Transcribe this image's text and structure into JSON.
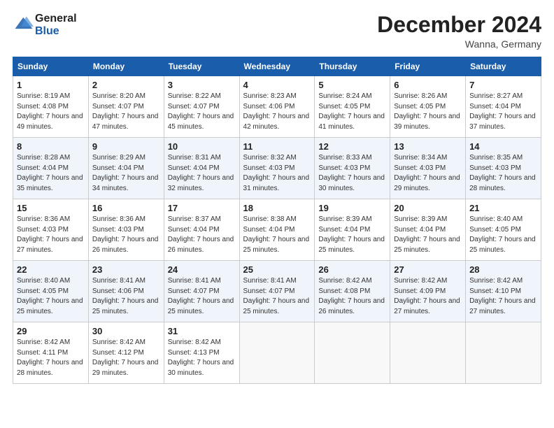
{
  "header": {
    "logo_general": "General",
    "logo_blue": "Blue",
    "month_title": "December 2024",
    "location": "Wanna, Germany"
  },
  "weekdays": [
    "Sunday",
    "Monday",
    "Tuesday",
    "Wednesday",
    "Thursday",
    "Friday",
    "Saturday"
  ],
  "weeks": [
    [
      {
        "day": "1",
        "sunrise": "8:19 AM",
        "sunset": "4:08 PM",
        "daylight": "7 hours and 49 minutes."
      },
      {
        "day": "2",
        "sunrise": "8:20 AM",
        "sunset": "4:07 PM",
        "daylight": "7 hours and 47 minutes."
      },
      {
        "day": "3",
        "sunrise": "8:22 AM",
        "sunset": "4:07 PM",
        "daylight": "7 hours and 45 minutes."
      },
      {
        "day": "4",
        "sunrise": "8:23 AM",
        "sunset": "4:06 PM",
        "daylight": "7 hours and 42 minutes."
      },
      {
        "day": "5",
        "sunrise": "8:24 AM",
        "sunset": "4:05 PM",
        "daylight": "7 hours and 41 minutes."
      },
      {
        "day": "6",
        "sunrise": "8:26 AM",
        "sunset": "4:05 PM",
        "daylight": "7 hours and 39 minutes."
      },
      {
        "day": "7",
        "sunrise": "8:27 AM",
        "sunset": "4:04 PM",
        "daylight": "7 hours and 37 minutes."
      }
    ],
    [
      {
        "day": "8",
        "sunrise": "8:28 AM",
        "sunset": "4:04 PM",
        "daylight": "7 hours and 35 minutes."
      },
      {
        "day": "9",
        "sunrise": "8:29 AM",
        "sunset": "4:04 PM",
        "daylight": "7 hours and 34 minutes."
      },
      {
        "day": "10",
        "sunrise": "8:31 AM",
        "sunset": "4:04 PM",
        "daylight": "7 hours and 32 minutes."
      },
      {
        "day": "11",
        "sunrise": "8:32 AM",
        "sunset": "4:03 PM",
        "daylight": "7 hours and 31 minutes."
      },
      {
        "day": "12",
        "sunrise": "8:33 AM",
        "sunset": "4:03 PM",
        "daylight": "7 hours and 30 minutes."
      },
      {
        "day": "13",
        "sunrise": "8:34 AM",
        "sunset": "4:03 PM",
        "daylight": "7 hours and 29 minutes."
      },
      {
        "day": "14",
        "sunrise": "8:35 AM",
        "sunset": "4:03 PM",
        "daylight": "7 hours and 28 minutes."
      }
    ],
    [
      {
        "day": "15",
        "sunrise": "8:36 AM",
        "sunset": "4:03 PM",
        "daylight": "7 hours and 27 minutes."
      },
      {
        "day": "16",
        "sunrise": "8:36 AM",
        "sunset": "4:03 PM",
        "daylight": "7 hours and 26 minutes."
      },
      {
        "day": "17",
        "sunrise": "8:37 AM",
        "sunset": "4:04 PM",
        "daylight": "7 hours and 26 minutes."
      },
      {
        "day": "18",
        "sunrise": "8:38 AM",
        "sunset": "4:04 PM",
        "daylight": "7 hours and 25 minutes."
      },
      {
        "day": "19",
        "sunrise": "8:39 AM",
        "sunset": "4:04 PM",
        "daylight": "7 hours and 25 minutes."
      },
      {
        "day": "20",
        "sunrise": "8:39 AM",
        "sunset": "4:04 PM",
        "daylight": "7 hours and 25 minutes."
      },
      {
        "day": "21",
        "sunrise": "8:40 AM",
        "sunset": "4:05 PM",
        "daylight": "7 hours and 25 minutes."
      }
    ],
    [
      {
        "day": "22",
        "sunrise": "8:40 AM",
        "sunset": "4:05 PM",
        "daylight": "7 hours and 25 minutes."
      },
      {
        "day": "23",
        "sunrise": "8:41 AM",
        "sunset": "4:06 PM",
        "daylight": "7 hours and 25 minutes."
      },
      {
        "day": "24",
        "sunrise": "8:41 AM",
        "sunset": "4:07 PM",
        "daylight": "7 hours and 25 minutes."
      },
      {
        "day": "25",
        "sunrise": "8:41 AM",
        "sunset": "4:07 PM",
        "daylight": "7 hours and 25 minutes."
      },
      {
        "day": "26",
        "sunrise": "8:42 AM",
        "sunset": "4:08 PM",
        "daylight": "7 hours and 26 minutes."
      },
      {
        "day": "27",
        "sunrise": "8:42 AM",
        "sunset": "4:09 PM",
        "daylight": "7 hours and 27 minutes."
      },
      {
        "day": "28",
        "sunrise": "8:42 AM",
        "sunset": "4:10 PM",
        "daylight": "7 hours and 27 minutes."
      }
    ],
    [
      {
        "day": "29",
        "sunrise": "8:42 AM",
        "sunset": "4:11 PM",
        "daylight": "7 hours and 28 minutes."
      },
      {
        "day": "30",
        "sunrise": "8:42 AM",
        "sunset": "4:12 PM",
        "daylight": "7 hours and 29 minutes."
      },
      {
        "day": "31",
        "sunrise": "8:42 AM",
        "sunset": "4:13 PM",
        "daylight": "7 hours and 30 minutes."
      },
      null,
      null,
      null,
      null
    ]
  ]
}
